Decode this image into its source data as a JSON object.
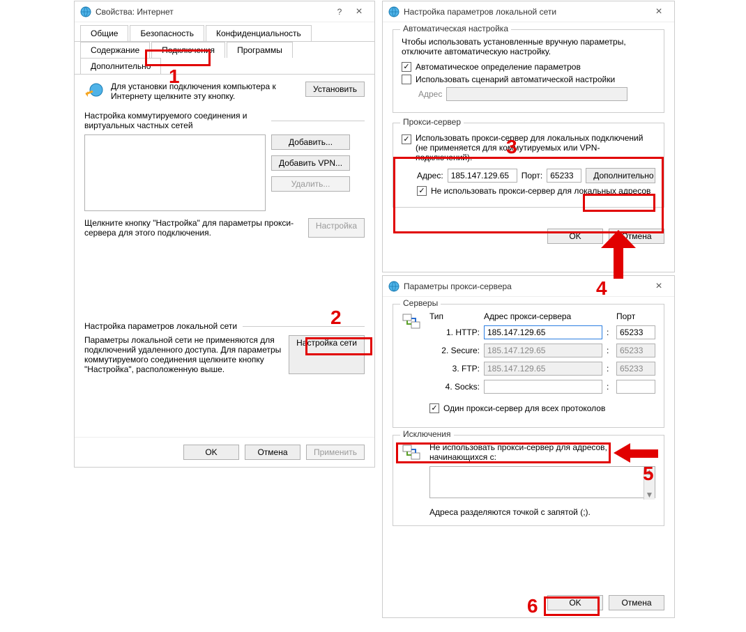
{
  "win1": {
    "title": "Свойства: Интернет",
    "help": "?",
    "close": "×",
    "tabs_row1": [
      "Общие",
      "Безопасность",
      "Конфиденциальность"
    ],
    "tabs_row2": [
      "Содержание",
      "Подключения",
      "Программы",
      "Дополнительно"
    ],
    "setup_text": "Для установки подключения компьютера к Интернету щелкните эту кнопку.",
    "setup_btn": "Установить",
    "dial_heading": "Настройка коммутируемого соединения и виртуальных частных сетей",
    "add_btn": "Добавить...",
    "add_vpn_btn": "Добавить VPN...",
    "remove_btn": "Удалить...",
    "settings_btn": "Настройка",
    "proxy_note": "Щелкните кнопку \"Настройка\" для параметры прокси-сервера для этого подключения.",
    "lan_heading": "Настройка параметров локальной сети",
    "lan_note": "Параметры локальной сети не применяются для подключений удаленного доступа. Для параметры коммутируемого соединения щелкните кнопку \"Настройка\", расположенную выше.",
    "lan_btn": "Настройка сети",
    "ok": "OK",
    "cancel": "Отмена",
    "apply": "Применить"
  },
  "win2": {
    "title": "Настройка параметров локальной сети",
    "close": "×",
    "auto_group": "Автоматическая настройка",
    "auto_note": "Чтобы использовать установленные вручную параметры, отключите автоматическую настройку.",
    "auto_detect": "Автоматическое определение параметров",
    "auto_script": "Использовать сценарий автоматической настройки",
    "address_label": "Адрес",
    "proxy_group": "Прокси-сервер",
    "use_proxy": "Использовать прокси-сервер для локальных подключений (не применяется для коммутируемых или VPN-подключений).",
    "addr_label": "Адрес:",
    "addr_value": "185.147.129.65",
    "port_label": "Порт:",
    "port_value": "65233",
    "advanced_btn": "Дополнительно",
    "bypass_local": "Не использовать прокси-сервер для локальных адресов",
    "ok": "OK",
    "cancel": "Отмена"
  },
  "win3": {
    "title": "Параметры прокси-сервера",
    "close": "×",
    "servers_group": "Серверы",
    "col_type": "Тип",
    "col_addr": "Адрес прокси-сервера",
    "col_port": "Порт",
    "rows": [
      {
        "label": "1. HTTP:",
        "addr": "185.147.129.65",
        "port": "65233",
        "enabled": true
      },
      {
        "label": "2. Secure:",
        "addr": "185.147.129.65",
        "port": "65233",
        "enabled": false
      },
      {
        "label": "3. FTP:",
        "addr": "185.147.129.65",
        "port": "65233",
        "enabled": false
      },
      {
        "label": "4. Socks:",
        "addr": "",
        "port": "",
        "enabled": true
      }
    ],
    "same_proxy": "Один прокси-сервер для всех протоколов",
    "exceptions_group": "Исключения",
    "exceptions_note": "Не использовать прокси-сервер для адресов, начинающихся с:",
    "exceptions_hint": "Адреса разделяются точкой с запятой (;).",
    "ok": "OK",
    "cancel": "Отмена"
  },
  "steps": {
    "1": "1",
    "2": "2",
    "3": "3",
    "4": "4",
    "5": "5",
    "6": "6"
  }
}
